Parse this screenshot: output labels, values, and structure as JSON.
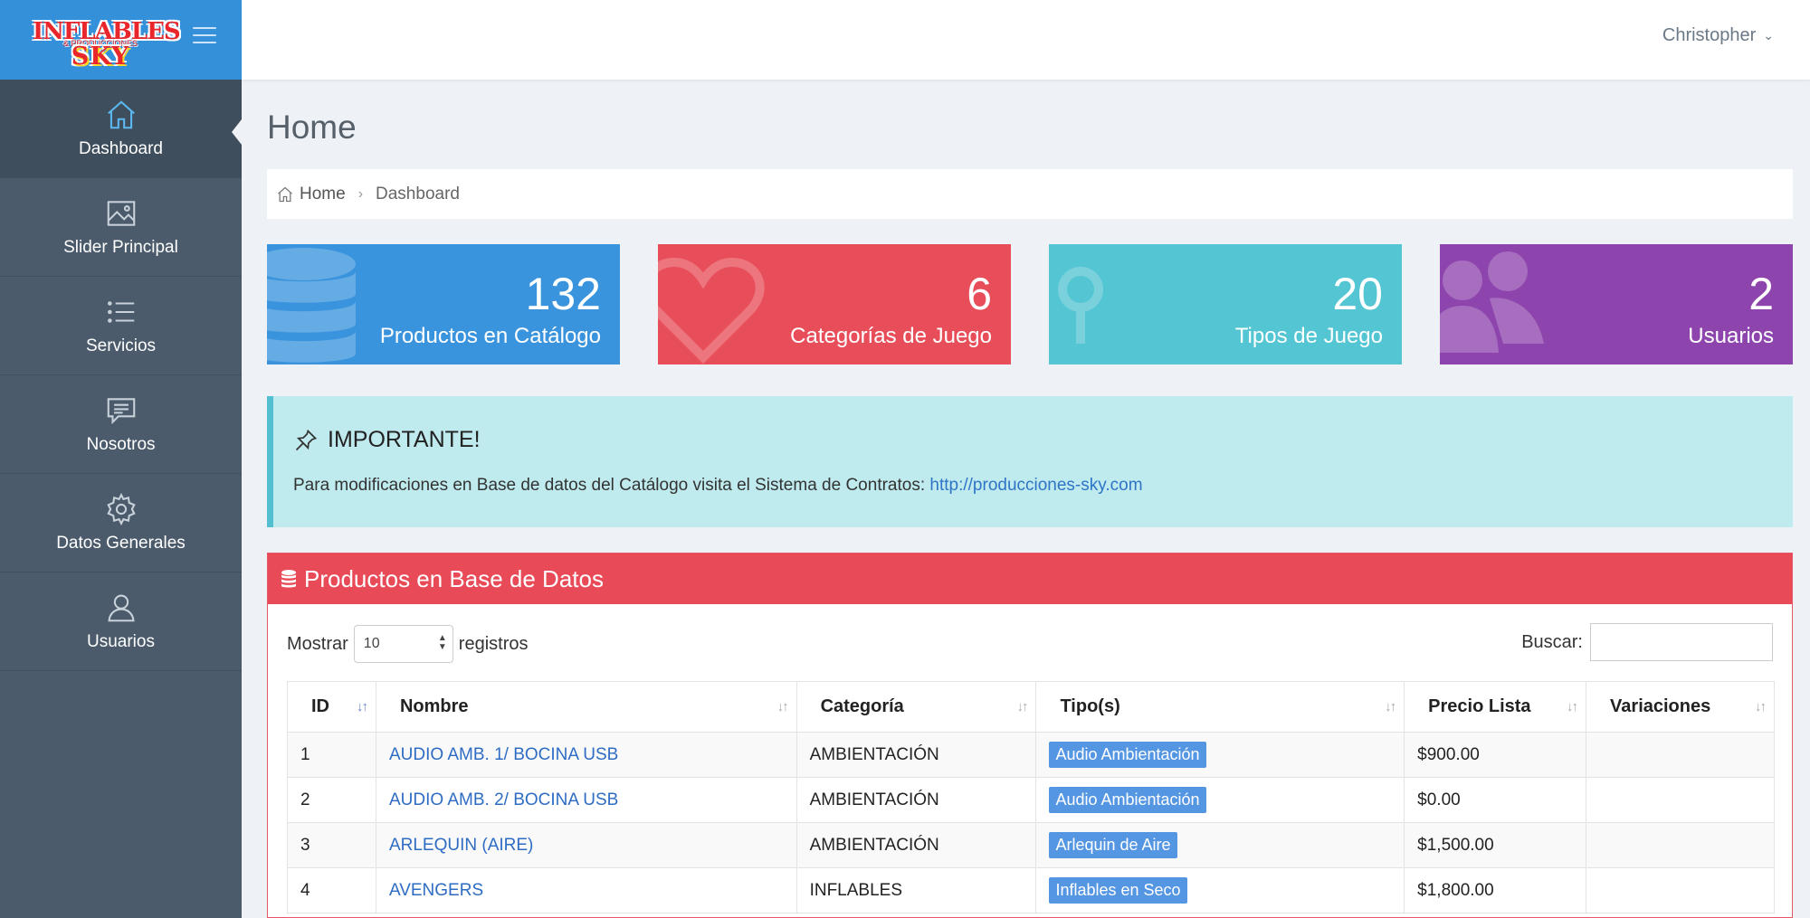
{
  "brand": {
    "logo_line1": "INFLABLES",
    "logo_line2": "& PRODUCCIONES",
    "logo_line3": "SKY",
    "accent": "#3590da"
  },
  "sidebar": {
    "items": [
      {
        "label": "Dashboard",
        "icon": "home-icon",
        "active": true
      },
      {
        "label": "Slider Principal",
        "icon": "image-icon",
        "active": false
      },
      {
        "label": "Servicios",
        "icon": "list-icon",
        "active": false
      },
      {
        "label": "Nosotros",
        "icon": "chat-icon",
        "active": false
      },
      {
        "label": "Datos Generales",
        "icon": "gear-icon",
        "active": false
      },
      {
        "label": "Usuarios",
        "icon": "user-icon",
        "active": false
      }
    ]
  },
  "header": {
    "user_name": "Christopher",
    "page_title": "Home"
  },
  "breadcrumb": {
    "home": "Home",
    "current": "Dashboard"
  },
  "stats": [
    {
      "value": "132",
      "label": "Productos en Catálogo",
      "color": "#3a94dd",
      "icon": "database-icon"
    },
    {
      "value": "6",
      "label": "Categorías de Juego",
      "color": "#e84e5a",
      "icon": "heart-icon"
    },
    {
      "value": "20",
      "label": "Tipos de Juego",
      "color": "#54c5d3",
      "icon": "stethoscope-icon"
    },
    {
      "value": "2",
      "label": "Usuarios",
      "color": "#8e44ad",
      "icon": "users-icon"
    }
  ],
  "alert": {
    "title": "IMPORTANTE!",
    "message": "Para modificaciones en Base de datos del Catálogo visita el Sistema de Contratos: ",
    "link": "http://producciones-sky.com"
  },
  "panel": {
    "title": "Productos en Base de Datos",
    "show_label": "Mostrar",
    "page_size": "10",
    "records_label": "registros",
    "search_label": "Buscar:",
    "search_value": ""
  },
  "table": {
    "columns": [
      "ID",
      "Nombre",
      "Categoría",
      "Tipo(s)",
      "Precio Lista",
      "Variaciones"
    ],
    "rows": [
      {
        "id": "1",
        "nombre": "AUDIO AMB. 1/ BOCINA USB",
        "categoria": "AMBIENTACIÓN",
        "tipo": "Audio Ambientación",
        "precio": "$900.00",
        "variaciones": ""
      },
      {
        "id": "2",
        "nombre": "AUDIO AMB. 2/ BOCINA USB",
        "categoria": "AMBIENTACIÓN",
        "tipo": "Audio Ambientación",
        "precio": "$0.00",
        "variaciones": ""
      },
      {
        "id": "3",
        "nombre": "ARLEQUIN (AIRE)",
        "categoria": "AMBIENTACIÓN",
        "tipo": "Arlequin de Aire",
        "precio": "$1,500.00",
        "variaciones": ""
      },
      {
        "id": "4",
        "nombre": "AVENGERS",
        "categoria": "INFLABLES",
        "tipo": "Inflables en Seco",
        "precio": "$1,800.00",
        "variaciones": ""
      }
    ]
  }
}
